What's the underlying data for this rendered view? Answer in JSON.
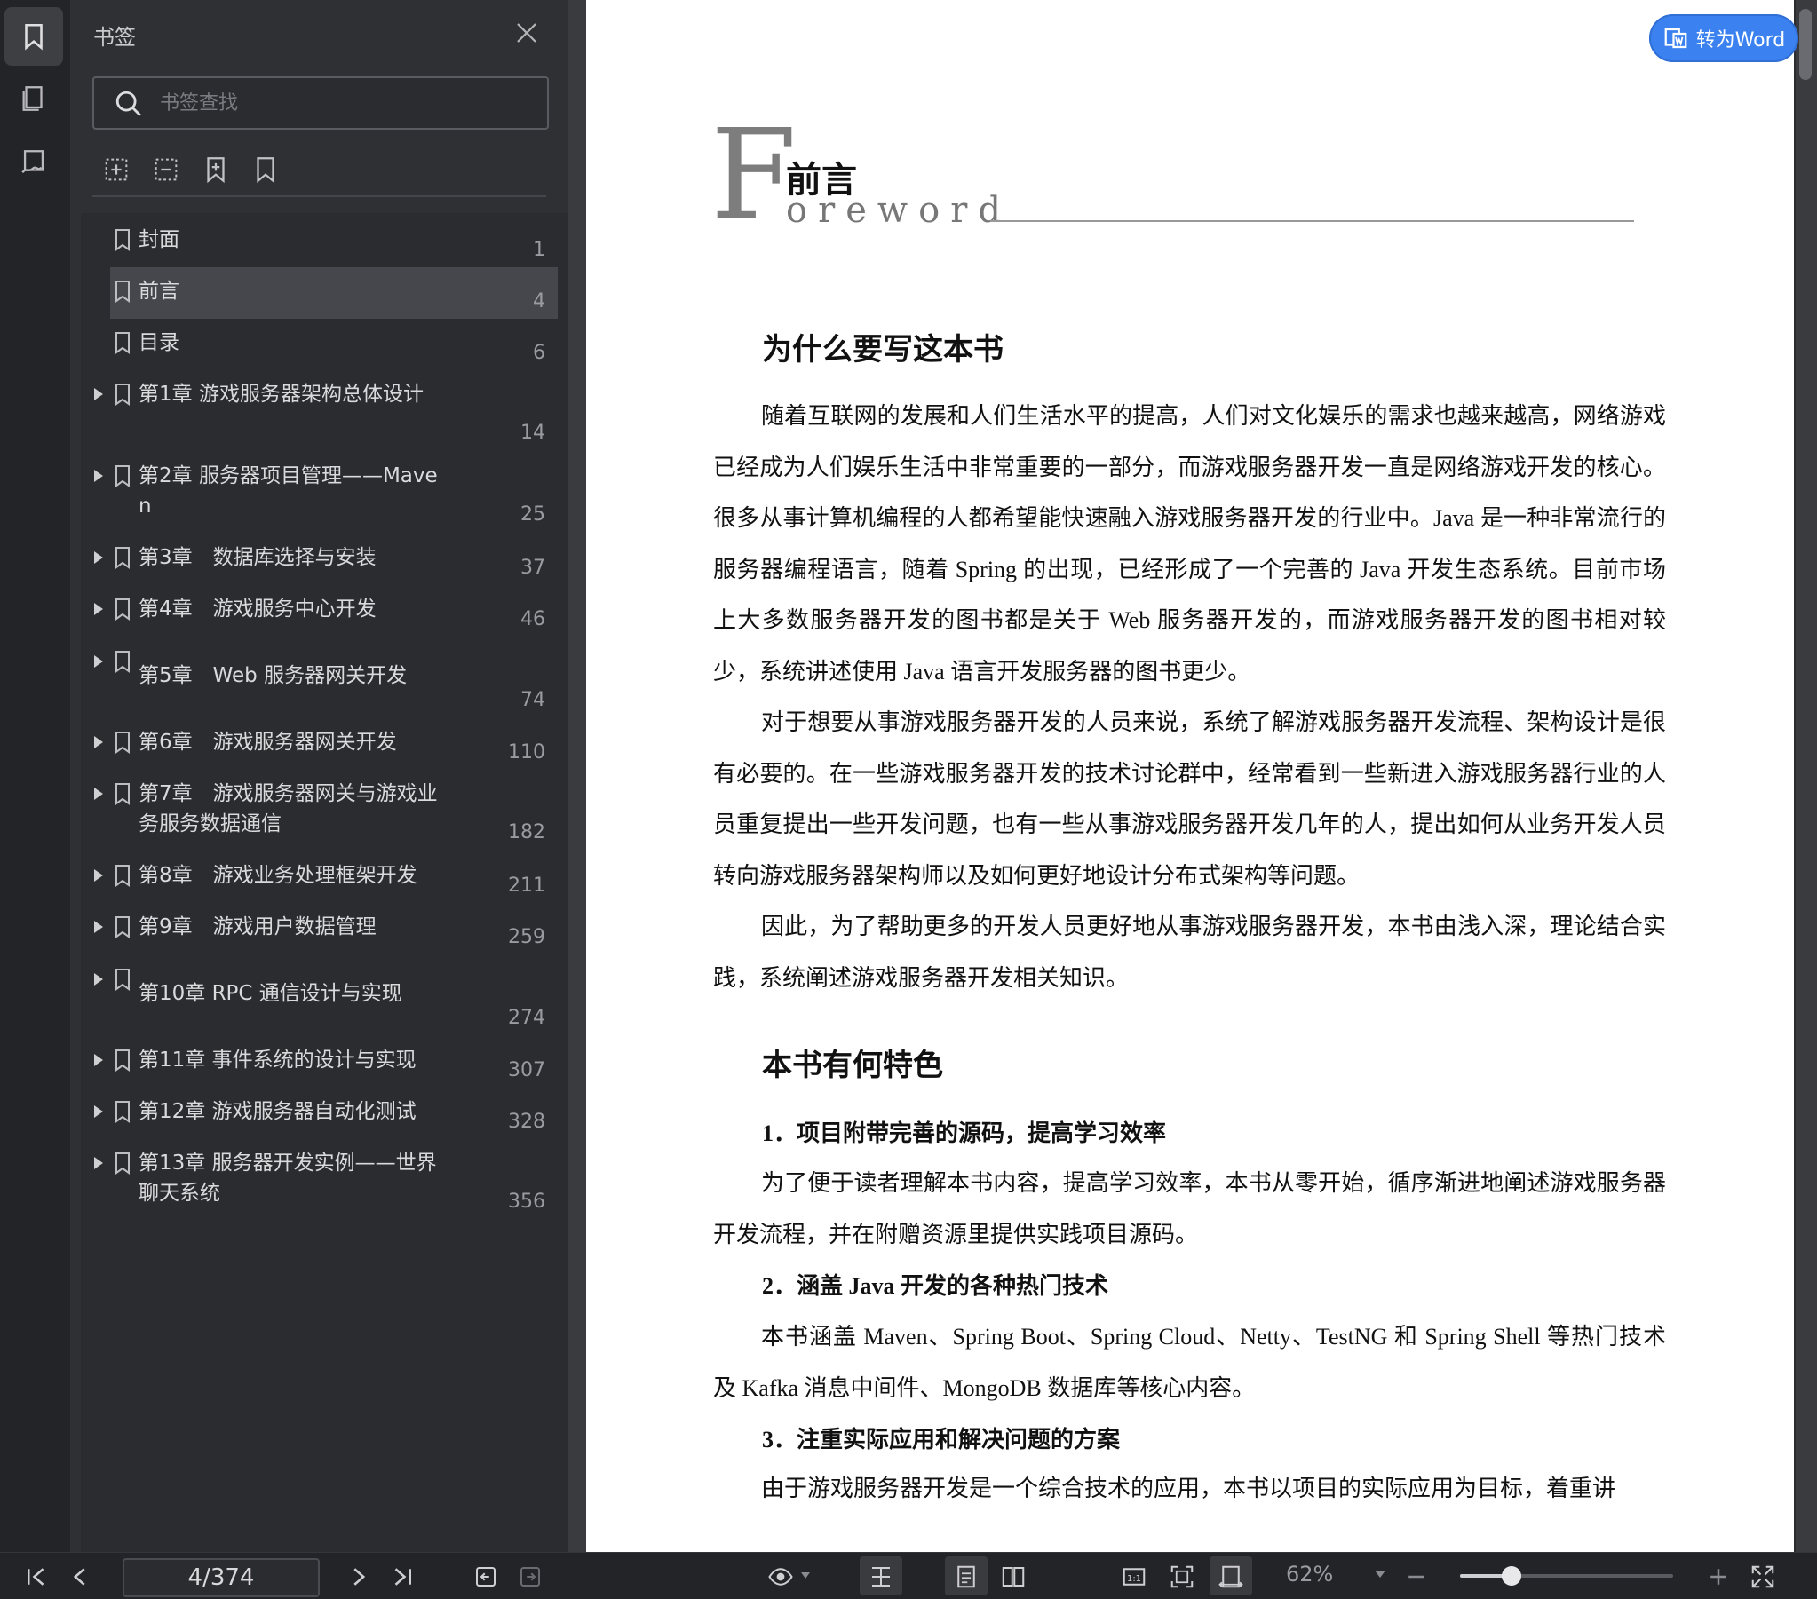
{
  "sidebar_panel": {
    "title": "书签",
    "search_placeholder": "书签查找",
    "bookmarks": [
      {
        "label": "封面",
        "page": "1"
      },
      {
        "label": "前言",
        "page": "4"
      },
      {
        "label": "目录",
        "page": "6"
      },
      {
        "label": "第1章 游戏服务器架构总体设计",
        "page": "14"
      },
      {
        "label": "第2章 服务器项目管理——Maven",
        "page": "25"
      },
      {
        "label": "第3章　数据库选择与安装",
        "page": "37"
      },
      {
        "label": "第4章　游戏服务中心开发",
        "page": "46"
      },
      {
        "label": "第5章　Web 服务器网关开发",
        "page": "74"
      },
      {
        "label": "第6章　游戏服务器网关开发",
        "page": "110"
      },
      {
        "label": "第7章　游戏服务器网关与游戏业务服务数据通信",
        "page": "182"
      },
      {
        "label": "第8章　游戏业务处理框架开发",
        "page": "211"
      },
      {
        "label": "第9章　游戏用户数据管理",
        "page": "259"
      },
      {
        "label": "第10章 RPC 通信设计与实现",
        "page": "274"
      },
      {
        "label": "第11章 事件系统的设计与实现",
        "page": "307"
      },
      {
        "label": "第12章 游戏服务器自动化测试",
        "page": "328"
      },
      {
        "label": "第13章 服务器开发实例——世界聊天系统",
        "page": "356"
      }
    ],
    "selected_index": 1
  },
  "convert_button": "转为Word",
  "document": {
    "fw_letter": "F",
    "fw_title": "前言",
    "fw_sub": "oreword",
    "section1": "为什么要写这本书",
    "p1": "随着互联网的发展和人们生活水平的提高，人们对文化娱乐的需求也越来越高，网络游戏已经成为人们娱乐生活中非常重要的一部分，而游戏服务器开发一直是网络游戏开发的核心。很多从事计算机编程的人都希望能快速融入游戏服务器开发的行业中。Java 是一种非常流行的服务器编程语言，随着 Spring 的出现，已经形成了一个完善的 Java 开发生态系统。目前市场上大多数服务器开发的图书都是关于 Web 服务器开发的，而游戏服务器开发的图书相对较少，系统讲述使用 Java 语言开发服务器的图书更少。",
    "p2": "对于想要从事游戏服务器开发的人员来说，系统了解游戏服务器开发流程、架构设计是很有必要的。在一些游戏服务器开发的技术讨论群中，经常看到一些新进入游戏服务器行业的人员重复提出一些开发问题，也有一些从事游戏服务器开发几年的人，提出如何从业务开发人员转向游戏服务器架构师以及如何更好地设计分布式架构等问题。",
    "p3": "因此，为了帮助更多的开发人员更好地从事游戏服务器开发，本书由浅入深，理论结合实践，系统阐述游戏服务器开发相关知识。",
    "section2": "本书有何特色",
    "h1": "1．项目附带完善的源码，提高学习效率",
    "p4": "为了便于读者理解本书内容，提高学习效率，本书从零开始，循序渐进地阐述游戏服务器开发流程，并在附赠资源里提供实践项目源码。",
    "h2": "2．涵盖 Java 开发的各种热门技术",
    "p5": "本书涵盖 Maven、Spring Boot、Spring Cloud、Netty、TestNG 和 Spring Shell 等热门技术及 Kafka 消息中间件、MongoDB 数据库等核心内容。",
    "h3": "3．注重实际应用和解决问题的方案",
    "p6": "由于游戏服务器开发是一个综合技术的应用，本书以项目的实际应用为目标，着重讲"
  },
  "bottom_bar": {
    "page_indicator": "4/374",
    "zoom": "62%",
    "zoom_fraction": 0.24
  }
}
